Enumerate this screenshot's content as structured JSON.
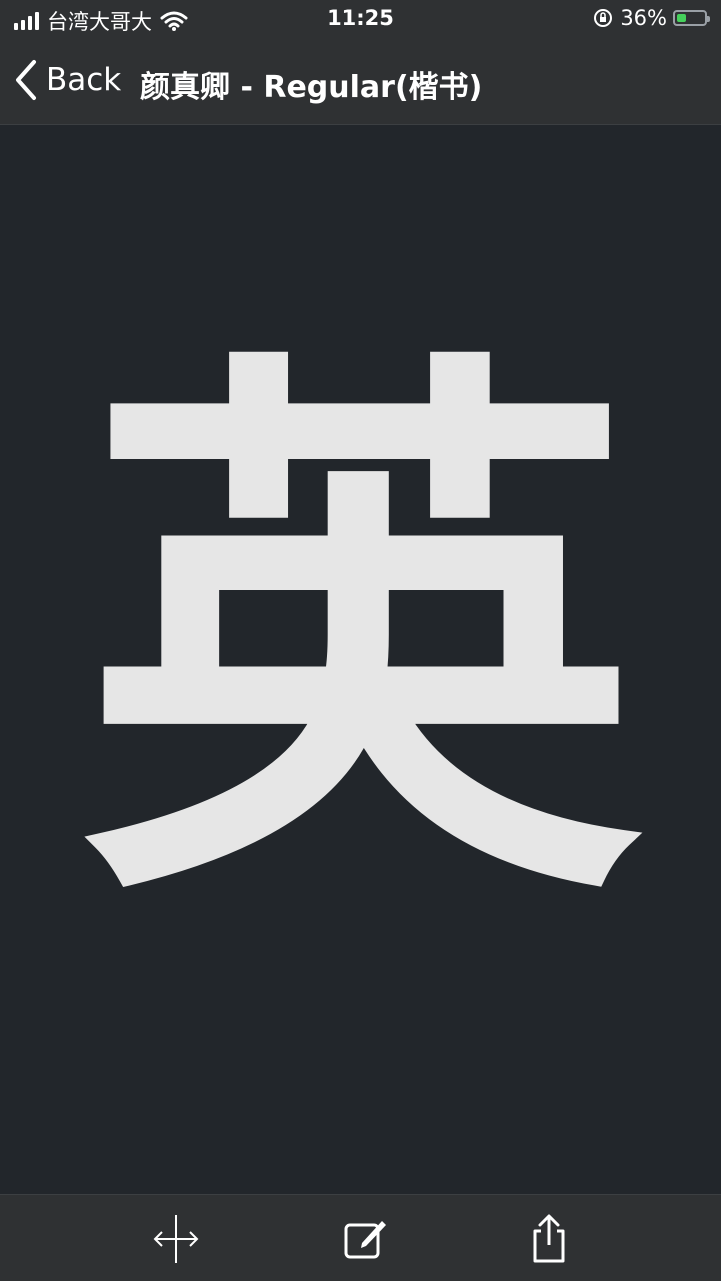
{
  "status_bar": {
    "carrier": "台湾大哥大",
    "time": "11:25",
    "battery_percent": "36%",
    "battery_level": 0.36,
    "battery_color": "#45d15b"
  },
  "navbar": {
    "back_label": "Back",
    "title": "颜真卿 - Regular(楷书)"
  },
  "content": {
    "character": "英",
    "character_color": "#e6e6e6"
  },
  "toolbar": {
    "icons": [
      "resize-icon",
      "edit-icon",
      "share-icon"
    ]
  }
}
